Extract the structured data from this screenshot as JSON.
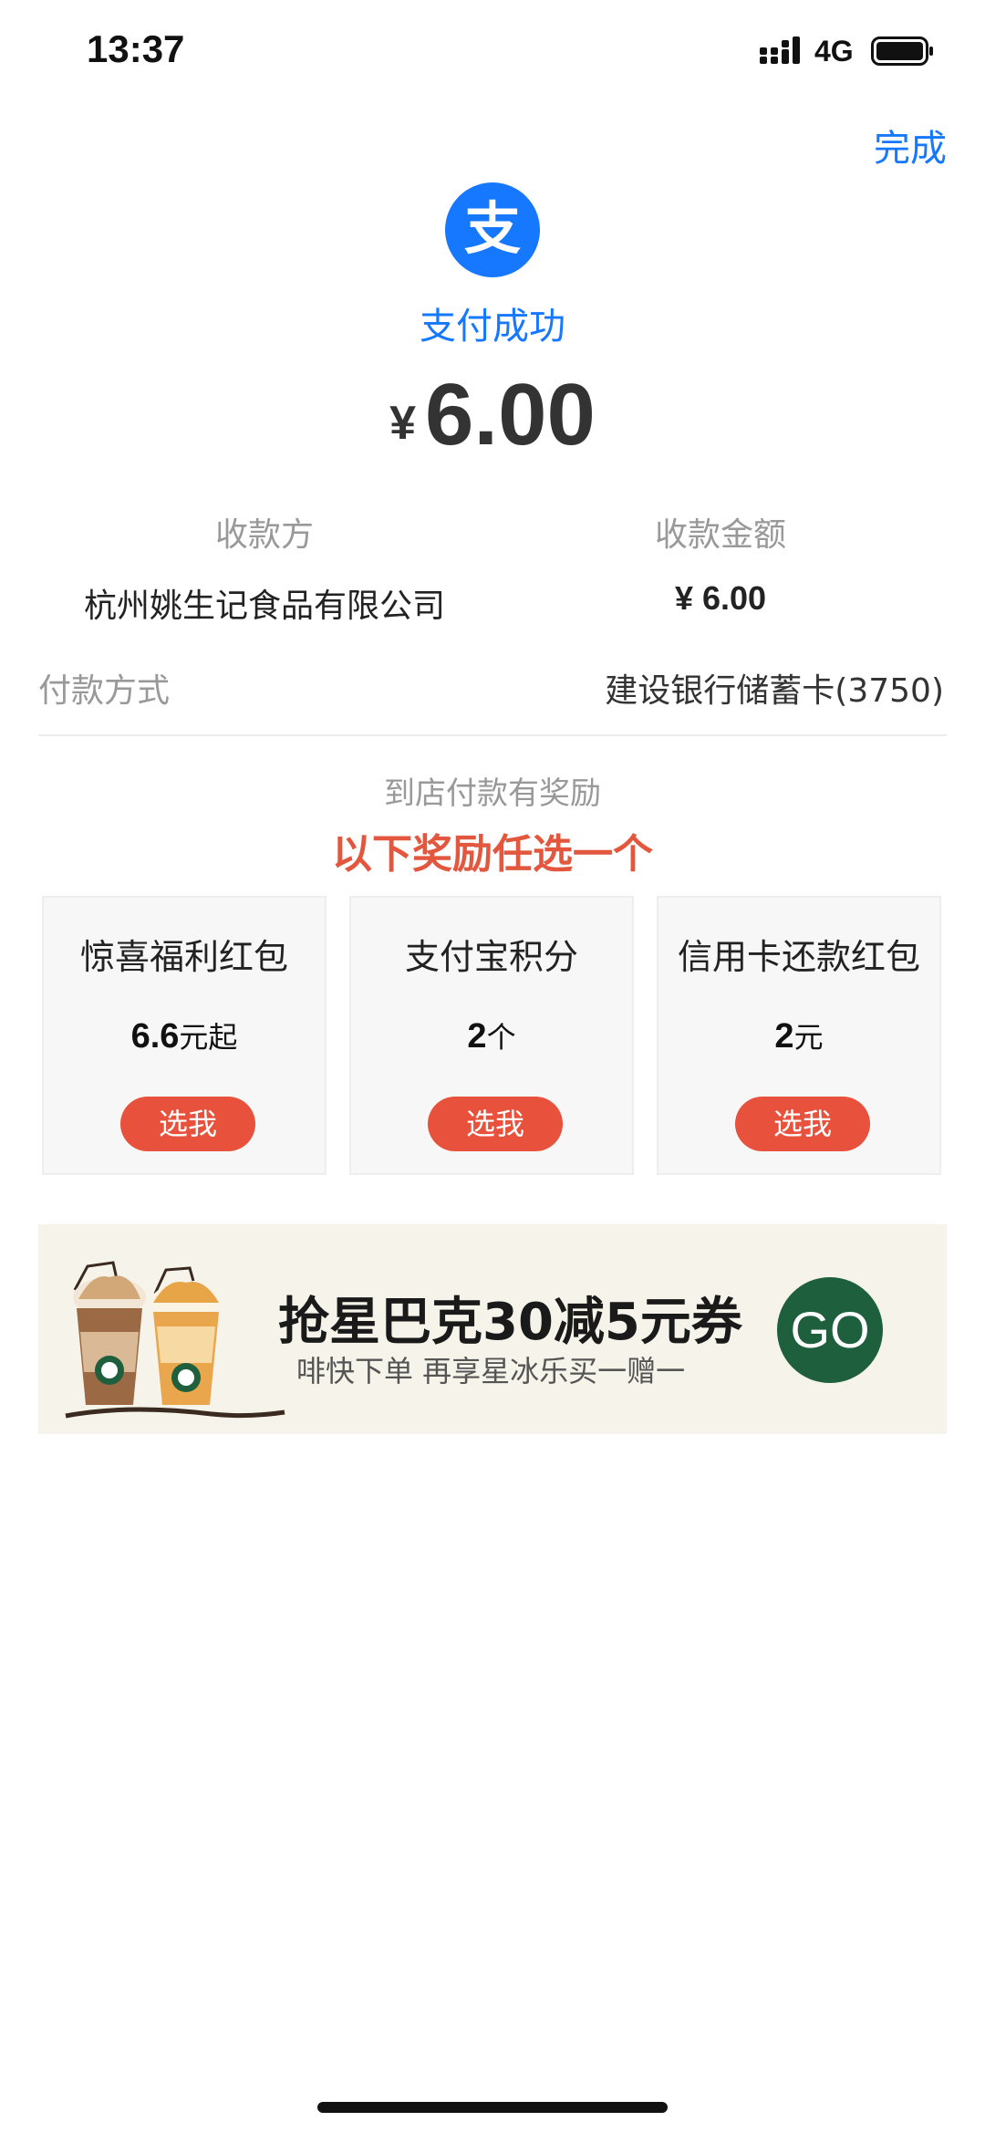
{
  "status_bar": {
    "time": "13:37",
    "network": "4G",
    "signal_icon": "signal-bars-icon",
    "battery_icon": "battery-icon"
  },
  "header": {
    "done_label": "完成"
  },
  "payment": {
    "logo_icon": "alipay-logo-icon",
    "logo_glyph": "支",
    "status": "支付成功",
    "currency_symbol": "¥",
    "amount": "6.00",
    "payee_label": "收款方",
    "payee_name": "杭州姚生记食品有限公司",
    "received_label": "收款金额",
    "received_amount": "¥ 6.00",
    "method_label": "付款方式",
    "method_value": "建设银行储蓄卡(3750)"
  },
  "rewards": {
    "subtitle": "到店付款有奖励",
    "title": "以下奖励任选一个",
    "items": [
      {
        "title": "惊喜福利红包",
        "amount": "6.6",
        "unit": "元起",
        "button": "选我"
      },
      {
        "title": "支付宝积分",
        "amount": "2",
        "unit": "个",
        "button": "选我"
      },
      {
        "title": "信用卡还款红包",
        "amount": "2",
        "unit": "元",
        "button": "选我"
      }
    ]
  },
  "banner": {
    "title": "抢星巴克30减5元券",
    "subtitle": "啡快下单 再享星冰乐买一赠一",
    "button": "GO",
    "image_icon": "starbucks-frappuccino-icon"
  },
  "colors": {
    "accent_blue": "#1677ff",
    "reward_red": "#e2573d",
    "button_red": "#e8523c",
    "go_green": "#1e5f3d"
  }
}
